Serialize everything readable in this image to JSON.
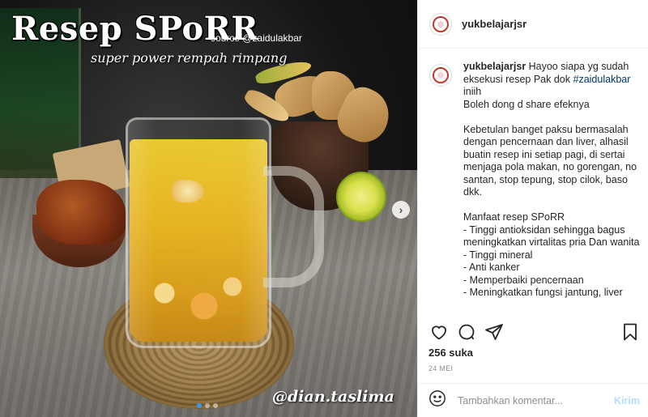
{
  "photo": {
    "title": "Resep SPoRR",
    "source": "source @zaidulakbar",
    "subtitle": "super power rempah rimpang",
    "watermark": "@dian.taslima",
    "next_icon": "chevron-right-icon",
    "carousel_dots": 3,
    "carousel_active": 0
  },
  "header": {
    "username": "yukbelajarjsr"
  },
  "caption": {
    "username": "yukbelajarjsr",
    "text_before_tag": " Hayoo siapa yg sudah eksekusi resep Pak dok ",
    "hashtag": "#zaidulakbar",
    "text_after_tag": " iniih\nBoleh dong d share efeknya\n\nKebetulan banget paksu bermasalah dengan pencernaan dan liver, alhasil buatin resep ini setiap pagi, di sertai menjaga pola makan, no gorengan, no santan, stop tepung, stop cilok, baso dkk.\n\nManfaat resep SPoRR\n- Tinggi antioksidan sehingga bagus meningkatkan virtalitas pria Dan wanita\n- Tinggi mineral\n- Anti kanker\n- Memperbaiki pencernaan\n- Meningkatkan fungsi jantung, liver"
  },
  "actions": {
    "like_icon": "heart-icon",
    "comment_icon": "comment-icon",
    "share_icon": "share-icon",
    "save_icon": "bookmark-icon"
  },
  "likes": "256 suka",
  "date": "24 MEI",
  "comment": {
    "placeholder": "Tambahkan komentar...",
    "post_label": "Kirim",
    "emoji_icon": "smiley-icon"
  },
  "colors": {
    "link": "#00376b",
    "post_disabled": "#b2dffc",
    "dot_active": "#3897f0"
  }
}
